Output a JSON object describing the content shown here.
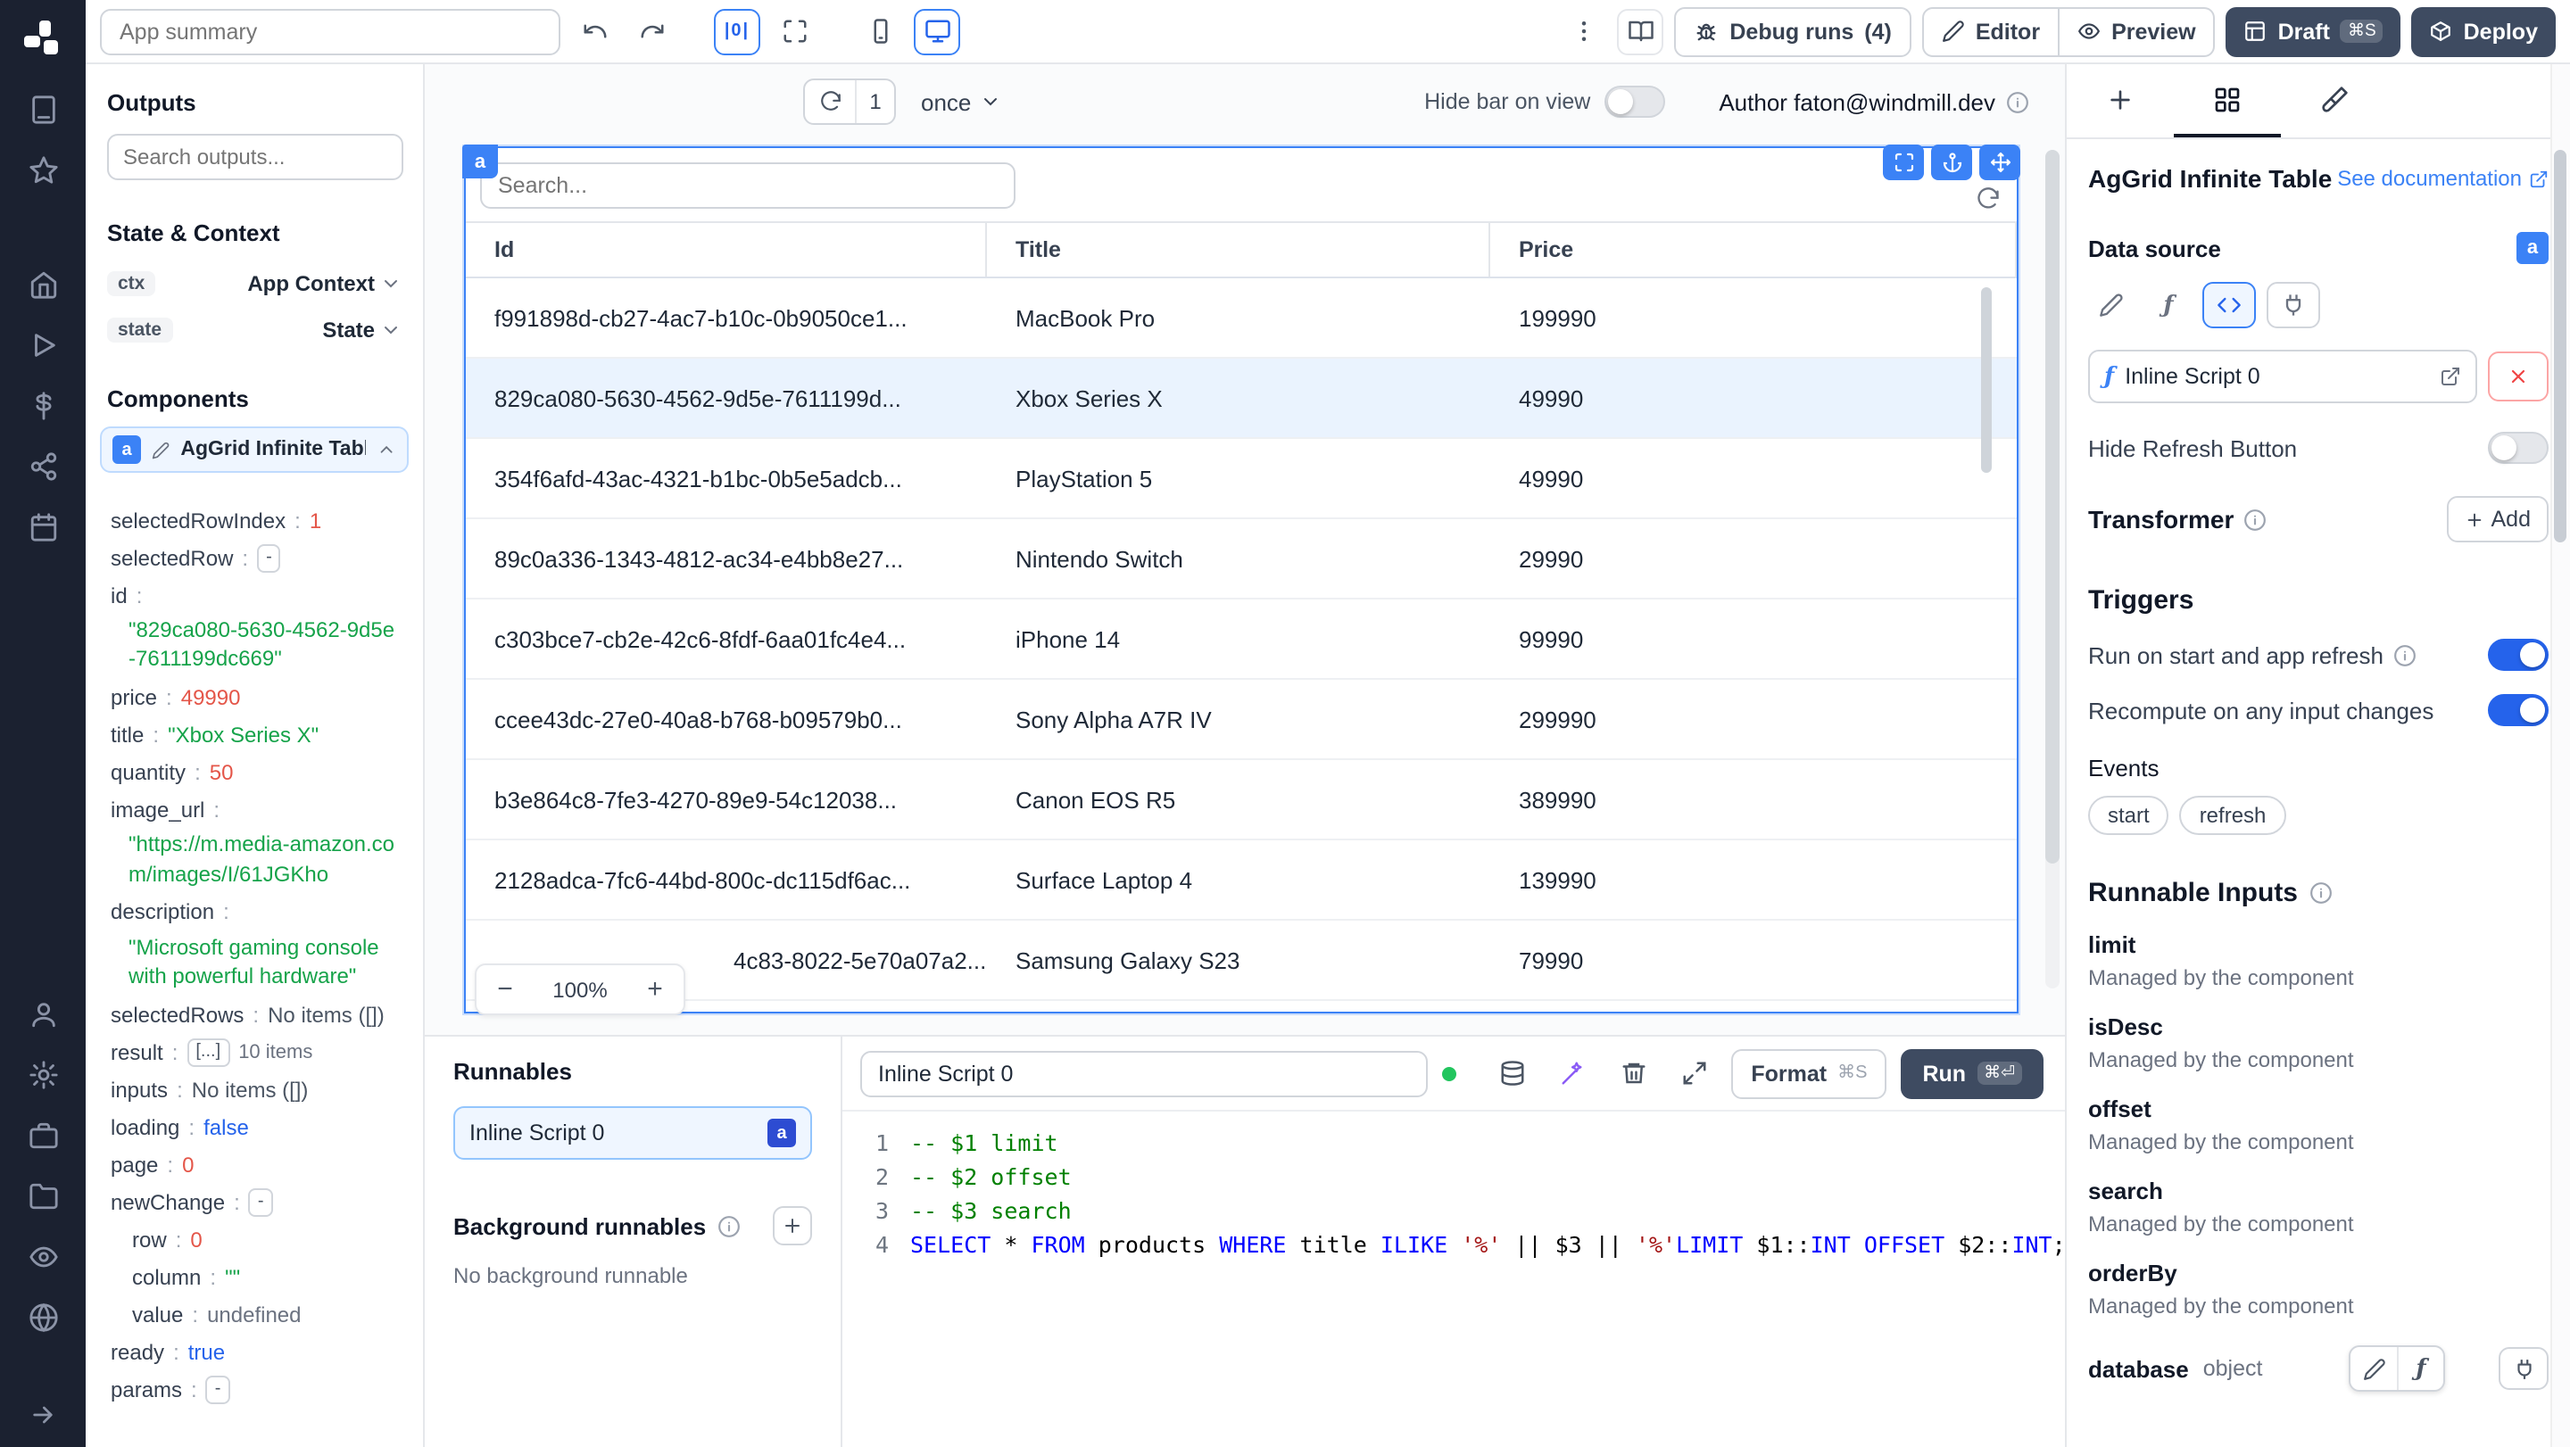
{
  "topbar": {
    "summary_placeholder": "App summary",
    "align_label": "|0|",
    "debug_runs_label": "Debug runs",
    "debug_runs_count": "(4)",
    "editor_label": "Editor",
    "preview_label": "Preview",
    "draft_label": "Draft",
    "draft_shortcut": "⌘S",
    "deploy_label": "Deploy"
  },
  "outputs": {
    "title": "Outputs",
    "search_placeholder": "Search outputs...",
    "state_context_title": "State & Context",
    "ctx_key": "ctx",
    "ctx_value": "App Context",
    "state_key": "state",
    "state_value": "State",
    "components_title": "Components",
    "component_badge": "a",
    "component_name": "AgGrid Infinite Table",
    "tree": [
      {
        "key": "selectedRowIndex",
        "value": "1",
        "type": "number"
      },
      {
        "key": "selectedRow",
        "value": "-",
        "type": "chip"
      },
      {
        "key": "id",
        "value": "\"829ca080-5630-4562-9d5e-7611199dc669\"",
        "type": "string",
        "block": true
      },
      {
        "key": "price",
        "value": "49990",
        "type": "number"
      },
      {
        "key": "title",
        "value": "\"Xbox Series X\"",
        "type": "string"
      },
      {
        "key": "quantity",
        "value": "50",
        "type": "number"
      },
      {
        "key": "image_url",
        "value": "\"https://m.media-amazon.com/images/I/61JGKho",
        "type": "string",
        "block": true
      },
      {
        "key": "description",
        "value": "\"Microsoft gaming console with powerful hardware\"",
        "type": "string",
        "block": true
      },
      {
        "key": "selectedRows",
        "value": "No items ([])",
        "type": "plain"
      },
      {
        "key": "result",
        "value": "[...]",
        "type": "chip",
        "suffix": "10 items"
      },
      {
        "key": "inputs",
        "value": "No items ([])",
        "type": "plain"
      },
      {
        "key": "loading",
        "value": "false",
        "type": "bool"
      },
      {
        "key": "page",
        "value": "0",
        "type": "number"
      },
      {
        "key": "newChange",
        "value": "-",
        "type": "chip"
      },
      {
        "key": "row",
        "value": "0",
        "type": "number",
        "indent": 1
      },
      {
        "key": "column",
        "value": "\"\"",
        "type": "string",
        "indent": 1
      },
      {
        "key": "value",
        "value": "undefined",
        "type": "undef",
        "indent": 1
      },
      {
        "key": "ready",
        "value": "true",
        "type": "bool"
      },
      {
        "key": "params",
        "value": "-",
        "type": "chip"
      }
    ]
  },
  "canvas": {
    "refresh_count": "1",
    "interval_value": "once",
    "hide_bar_label": "Hide bar on view",
    "author_label": "Author faton@windmill.dev",
    "zoom_minus": "−",
    "zoom_value": "100%",
    "zoom_plus": "+"
  },
  "grid": {
    "tag": "a",
    "search_placeholder": "Search...",
    "columns": [
      "Id",
      "Title",
      "Price"
    ],
    "selected_index": 1,
    "rows": [
      [
        "f991898d-cb27-4ac7-b10c-0b9050ce1...",
        "MacBook Pro",
        "199990"
      ],
      [
        "829ca080-5630-4562-9d5e-7611199d...",
        "Xbox Series X",
        "49990"
      ],
      [
        "354f6afd-43ac-4321-b1bc-0b5e5adcb...",
        "PlayStation 5",
        "49990"
      ],
      [
        "89c0a336-1343-4812-ac34-e4bb8e27...",
        "Nintendo Switch",
        "29990"
      ],
      [
        "c303bce7-cb2e-42c6-8fdf-6aa01fc4e4...",
        "iPhone 14",
        "99990"
      ],
      [
        "ccee43dc-27e0-40a8-b768-b09579b0...",
        "Sony Alpha A7R IV",
        "299990"
      ],
      [
        "b3e864c8-7fe3-4270-89e9-54c12038...",
        "Canon EOS R5",
        "389990"
      ],
      [
        "2128adca-7fc6-44bd-800c-dc115df6ac...",
        "Surface Laptop 4",
        "139990"
      ],
      [
        "4c83-8022-5e70a07a2...",
        "Samsung Galaxy S23",
        "79990"
      ]
    ]
  },
  "runnables": {
    "title": "Runnables",
    "item_label": "Inline Script 0",
    "item_badge": "a",
    "background_title": "Background runnables",
    "background_empty": "No background runnable"
  },
  "editor": {
    "name_value": "Inline Script 0",
    "format_label": "Format",
    "format_shortcut": "⌘S",
    "run_label": "Run",
    "run_shortcut": "⌘⏎",
    "lines": [
      {
        "n": "1",
        "tokens": [
          [
            "-- $1 limit",
            "cm"
          ]
        ]
      },
      {
        "n": "2",
        "tokens": [
          [
            "-- $2 offset",
            "cm"
          ]
        ]
      },
      {
        "n": "3",
        "tokens": [
          [
            "-- $3 search",
            "cm"
          ]
        ]
      },
      {
        "n": "4",
        "tokens": [
          [
            "SELECT",
            "kw"
          ],
          [
            " * ",
            ""
          ],
          [
            "FROM",
            "kw"
          ],
          [
            " products ",
            ""
          ],
          [
            "WHERE",
            "kw"
          ],
          [
            " title ",
            ""
          ],
          [
            "ILIKE",
            "kw"
          ],
          [
            " ",
            ""
          ],
          [
            "'%'",
            "str"
          ],
          [
            " || $3 || ",
            ""
          ],
          [
            "'%'",
            "str"
          ],
          [
            "LIMIT",
            "kw"
          ],
          [
            " $1::",
            ""
          ],
          [
            "INT",
            "kw"
          ],
          [
            " ",
            ""
          ],
          [
            "OFFSET",
            "kw"
          ],
          [
            " $2::",
            ""
          ],
          [
            "INT",
            "kw"
          ],
          [
            ";",
            ""
          ]
        ]
      }
    ]
  },
  "settings": {
    "title": "AgGrid Infinite Table",
    "doc_link": "See documentation",
    "data_source_label": "Data source",
    "data_source_badge": "a",
    "script_name": "Inline Script 0",
    "hide_refresh_label": "Hide Refresh Button",
    "transformer_label": "Transformer",
    "add_label": "Add",
    "triggers_title": "Triggers",
    "trigger_start_label": "Run on start and app refresh",
    "trigger_recompute_label": "Recompute on any input changes",
    "events_label": "Events",
    "event_pills": [
      "start",
      "refresh"
    ],
    "runnable_inputs_title": "Runnable Inputs",
    "managed_label": "Managed by the component",
    "inputs": [
      "limit",
      "isDesc",
      "offset",
      "search",
      "orderBy"
    ],
    "database_label": "database",
    "database_type": "object"
  }
}
